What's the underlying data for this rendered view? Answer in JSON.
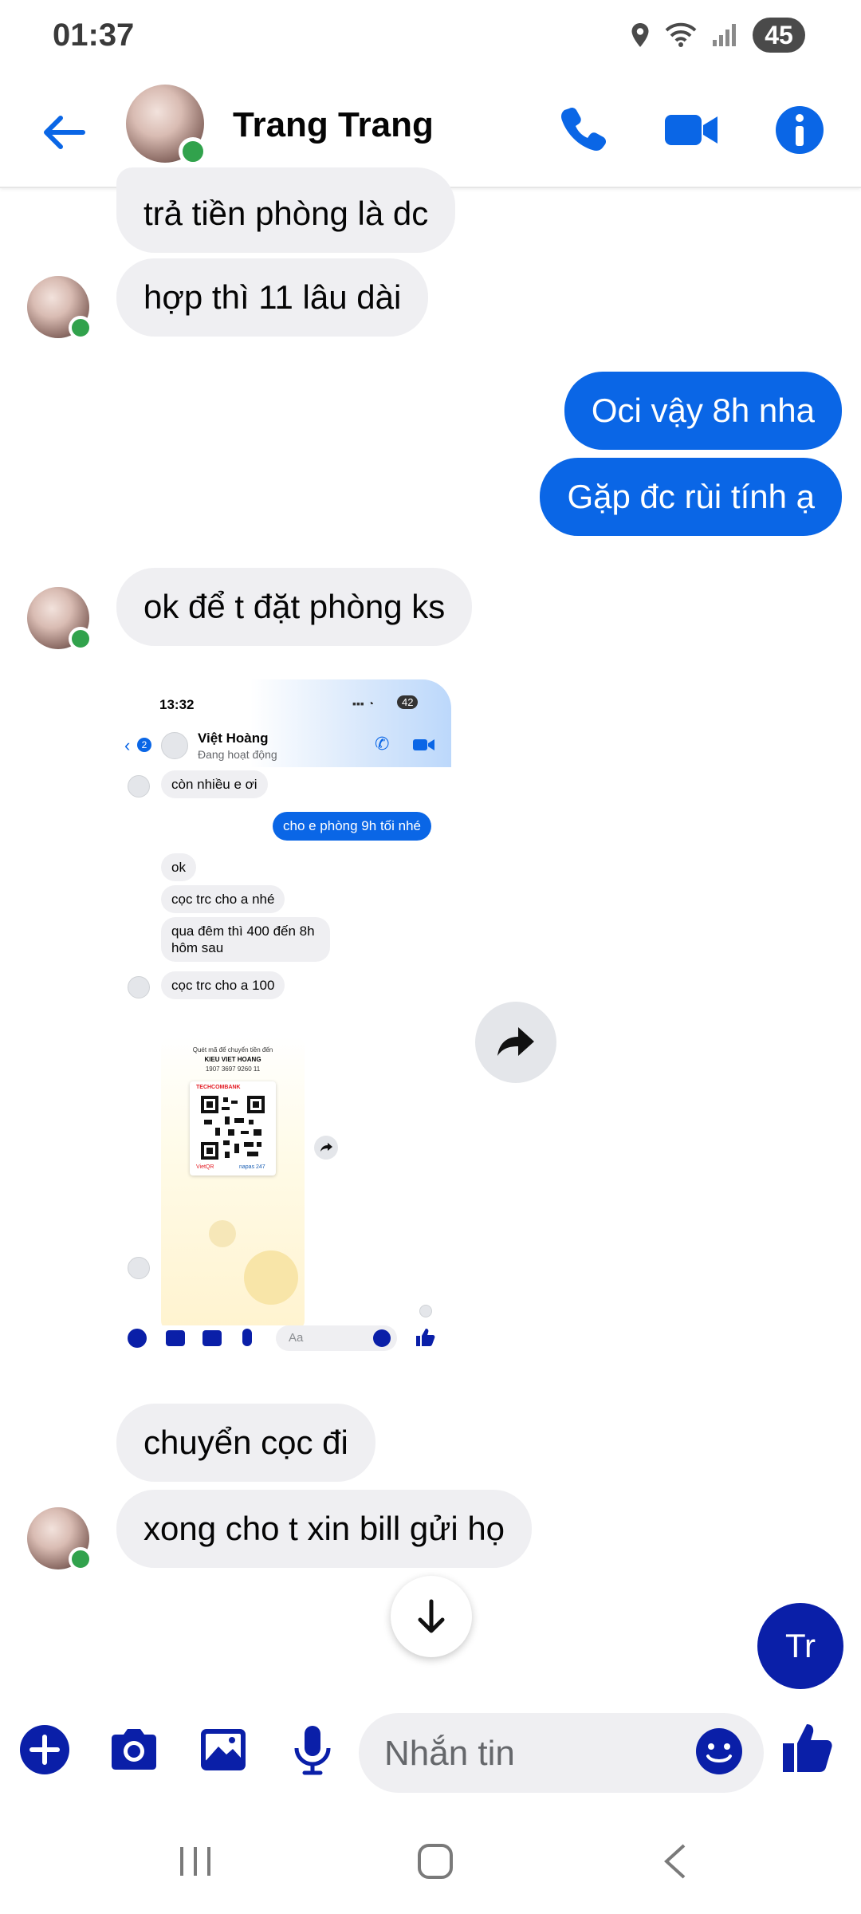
{
  "status_bar": {
    "time": "01:37",
    "battery": "45"
  },
  "header": {
    "contact_name": "Trang Trang"
  },
  "messages": [
    {
      "text": "trả tiền phòng là dc"
    },
    {
      "text": "hợp thì 11 lâu dài"
    },
    {
      "text": "Oci vậy 8h nha"
    },
    {
      "text": "Gặp đc rùi tính ạ"
    },
    {
      "text": "ok để t đặt phòng ks"
    },
    {
      "text": "chuyển cọc đi"
    },
    {
      "text": "xong cho t xin bill gửi họ"
    }
  ],
  "shared_screenshot": {
    "time": "13:32",
    "battery": "42",
    "back_badge": "2",
    "contact_name": "Việt Hoàng",
    "contact_status": "Đang hoạt động",
    "messages": [
      "còn nhiều e ơi",
      "cho e phòng 9h tối nhé",
      "ok",
      "cọc trc cho a nhé",
      "qua đêm thì 400 đến 8h hôm sau",
      "cọc trc cho a 100"
    ],
    "qr_caption_1": "Quét mã để chuyển tiền đến",
    "qr_caption_2": "KIEU VIET HOANG",
    "qr_caption_3": "1907 3697 9260 11",
    "bank_name": "TECHCOMBANK",
    "footer_left": "VietQR",
    "footer_right": "napas 247",
    "composer_placeholder": "Aa"
  },
  "chat_head_label": "Tr",
  "composer": {
    "placeholder": "Nhắn tin"
  },
  "colors": {
    "accent": "#0a66e6",
    "online": "#31a24c",
    "incoming_bubble": "#efeff2",
    "chat_head": "#0a1fa8"
  }
}
